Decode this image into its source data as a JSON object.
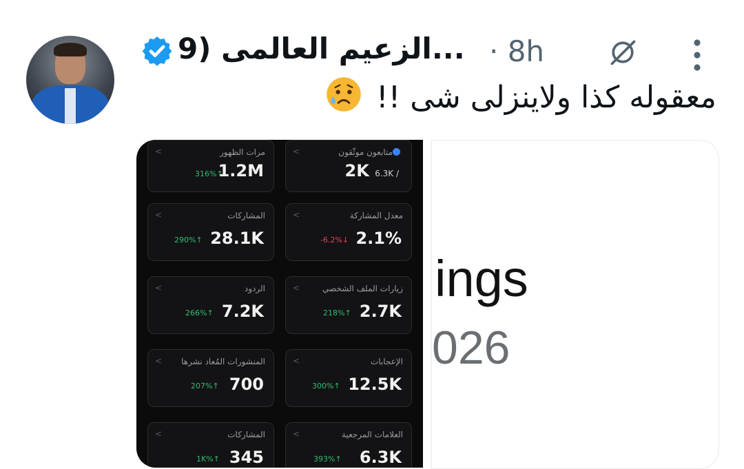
{
  "tweet": {
    "author_name": "الزعيم العالمى (9...",
    "time": "· 8h",
    "text": "معقوله كذا ولاينزلى شى !!",
    "emoji": "sad-sweat-face"
  },
  "icons": {
    "verified": "verified-badge-icon",
    "grok": "grok-icon",
    "more": "more-vertical-icon"
  },
  "colors": {
    "verified_blue": "#1d9bf0",
    "up_green": "#2fbf71",
    "down_red": "#e0445a"
  },
  "analytics": {
    "tiles": [
      {
        "label": "مرات الظهور",
        "value": "1.2M",
        "delta": "316%↑",
        "trend": "up"
      },
      {
        "label": "متابعون موثّقون",
        "value": "2K",
        "sub": "6.3K /",
        "verified": true
      },
      {
        "label": "المشاركات",
        "value": "28.1K",
        "delta": "290%↑",
        "trend": "up"
      },
      {
        "label": "معدل المشاركة",
        "value": "2.1%",
        "delta": "-6.2%↓",
        "trend": "down"
      },
      {
        "label": "الردود",
        "value": "7.2K",
        "delta": "266%↑",
        "trend": "up"
      },
      {
        "label": "زيارات الملف الشخصي",
        "value": "2.7K",
        "delta": "218%↑",
        "trend": "up"
      },
      {
        "label": "المنشورات المُعاد نشرها",
        "value": "700",
        "delta": "207%↑",
        "trend": "up"
      },
      {
        "label": "الإعجابات",
        "value": "12.5K",
        "delta": "300%↑",
        "trend": "up"
      },
      {
        "label": "المشاركات",
        "value": "345",
        "delta": "1K%↑",
        "trend": "up"
      },
      {
        "label": "العلامات المرجعية",
        "value": "6.3K",
        "delta": "393%↑",
        "trend": "up"
      }
    ]
  },
  "second_image": {
    "line1": "ings",
    "line2": "026"
  }
}
